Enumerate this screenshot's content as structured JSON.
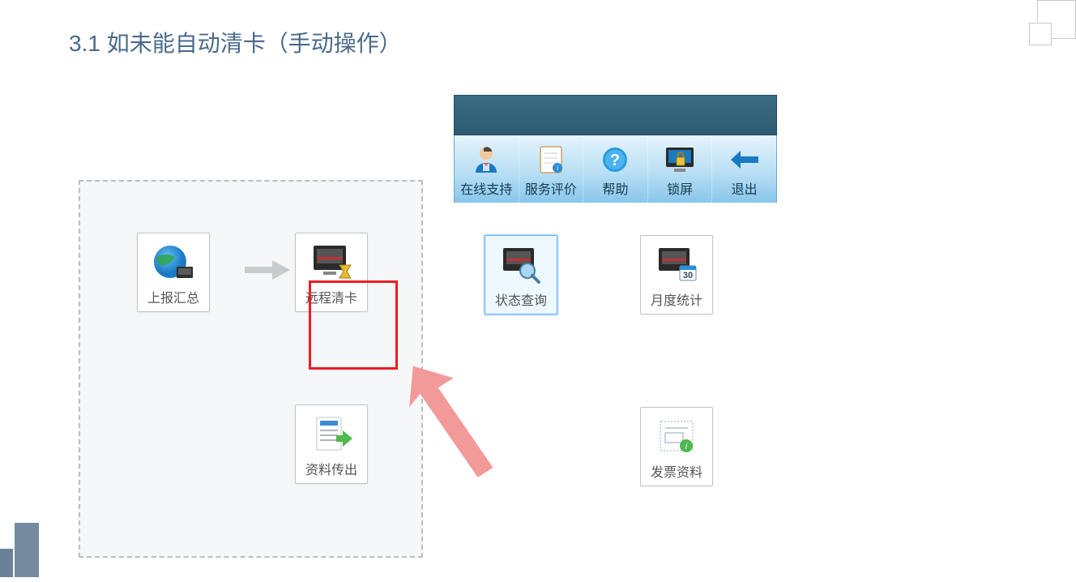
{
  "heading": "3.1  如未能自动清卡（手动操作）",
  "dashed_panel": {
    "report": "上报汇总",
    "remote_clear": "远程清卡",
    "export": "资料传出"
  },
  "toolbar": {
    "online_support": "在线支持",
    "service_rating": "服务评价",
    "help": "帮助",
    "lock": "锁屏",
    "exit": "退出"
  },
  "right_tiles": {
    "status_query": "状态查询",
    "monthly_stats": "月度统计",
    "invoice_info": "发票资料"
  }
}
